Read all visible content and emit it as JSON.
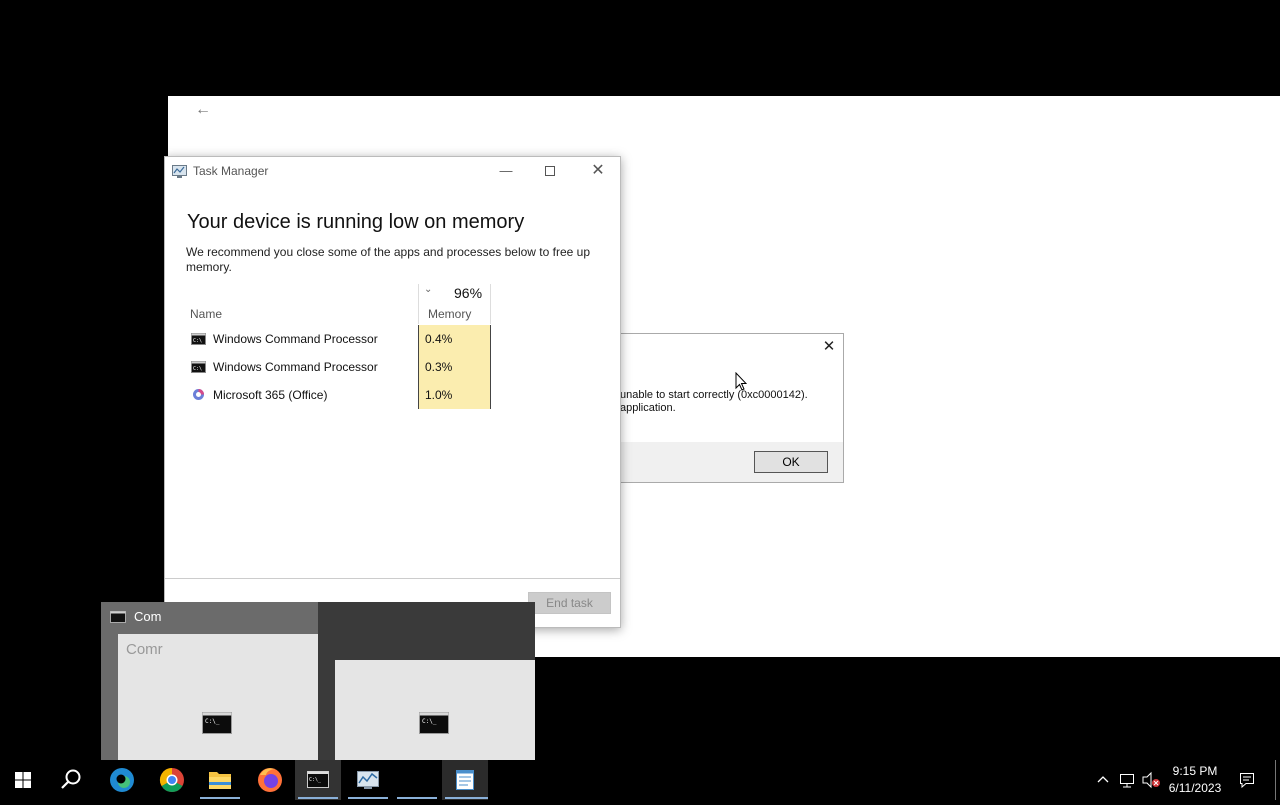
{
  "task_manager": {
    "title": "Task Manager",
    "heading": "Your device is running low on memory",
    "description": "We recommend you close some of the apps and processes below to free up memory.",
    "memory_total": "96%",
    "columns": {
      "name": "Name",
      "memory": "Memory"
    },
    "rows": [
      {
        "name": "Windows Command Processor",
        "memory": "0.4%",
        "icon": "cmd-icon"
      },
      {
        "name": "Windows Command Processor",
        "memory": "0.3%",
        "icon": "cmd-icon"
      },
      {
        "name": "Microsoft 365 (Office)",
        "memory": "1.0%",
        "icon": "office-icon"
      }
    ],
    "end_task_label": "End task",
    "highlight_color": "#fbedaf"
  },
  "error_dialog": {
    "line1": "unable to start correctly (0xc0000142).",
    "line2": "application.",
    "ok_label": "OK"
  },
  "taskbar_preview": {
    "label": "Com",
    "thumb_text": "Comr"
  },
  "taskbar": {
    "apps": [
      "start-icon",
      "search-icon",
      "edge-icon",
      "chrome-icon",
      "file-explorer-icon",
      "firefox-icon",
      "command-prompt-icon",
      "task-manager-icon",
      "notepad-icon"
    ],
    "time": "9:15 PM",
    "date": "6/11/2023"
  }
}
